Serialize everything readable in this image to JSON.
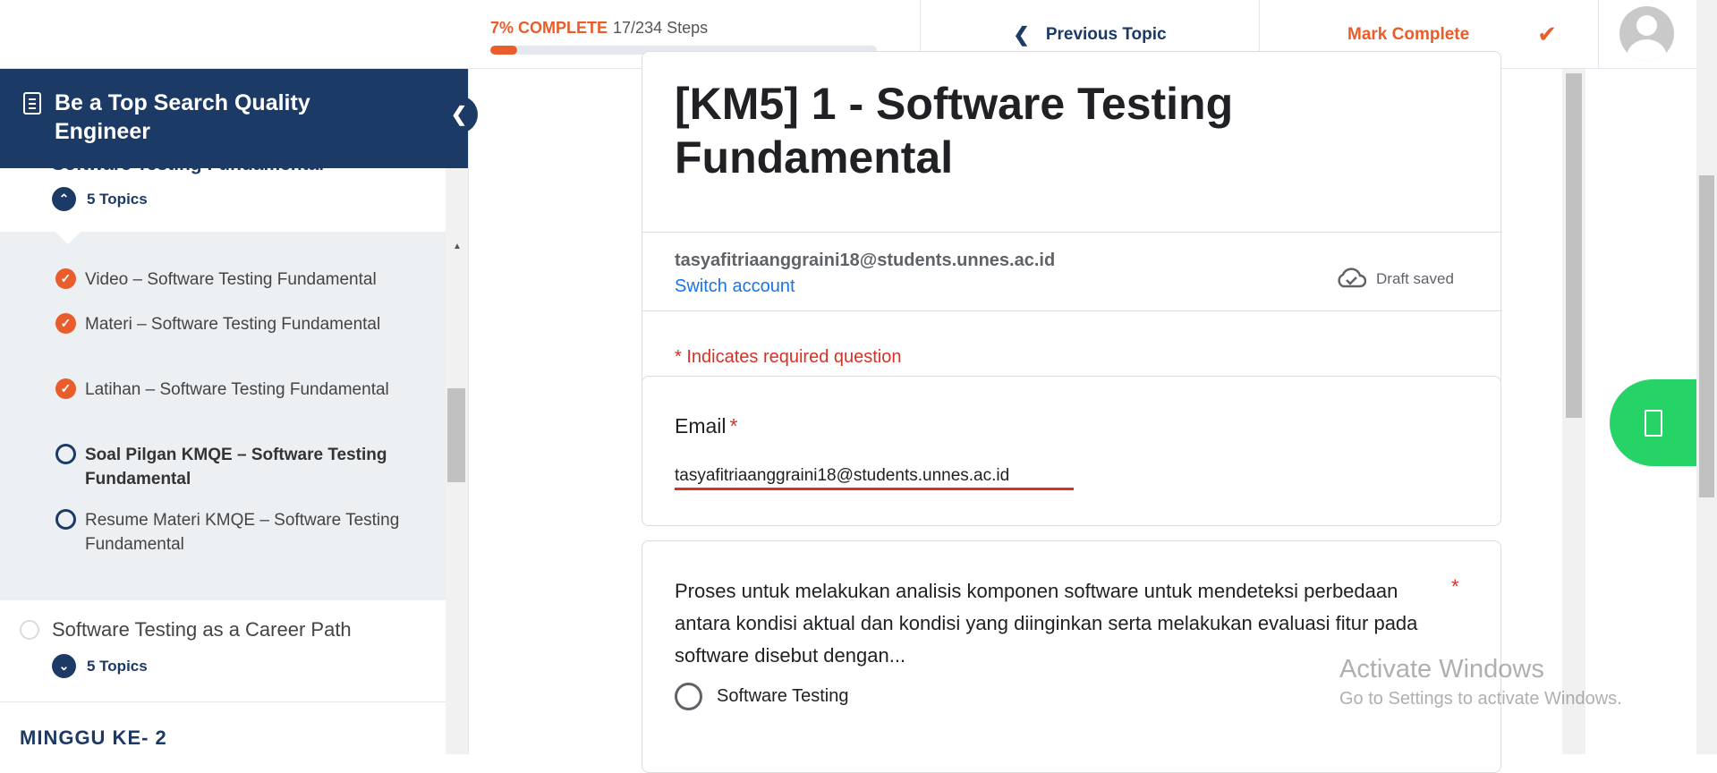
{
  "header": {
    "progress_percent_label": "7% COMPLETE",
    "progress_steps": "17/234 Steps",
    "progress_fraction": 0.07,
    "previous_topic_label": "Previous Topic",
    "mark_complete_label": "Mark Complete"
  },
  "sidebar": {
    "course_title": "Be a Top Search Quality Engineer",
    "current_lesson": "Software Testing Fundamental",
    "current_lesson_topics": "5 Topics",
    "topics": [
      {
        "label": "Video – Software Testing Fundamental",
        "status": "complete"
      },
      {
        "label": "Materi – Software Testing Fundamental",
        "status": "complete"
      },
      {
        "label": "Latihan – Software Testing Fundamental",
        "status": "complete"
      },
      {
        "label": "Soal Pilgan KMQE – Software Testing Fundamental",
        "status": "current"
      },
      {
        "label": "Resume Materi KMQE – Software Testing Fundamental",
        "status": "incomplete"
      }
    ],
    "next_lesson": "Software Testing as a Career Path",
    "next_lesson_topics": "5 Topics",
    "next_section": "MINGGU KE- 2"
  },
  "form": {
    "title": "[KM5] 1 - Software Testing Fundamental",
    "account_email": "tasyafitriaanggraini18@students.unnes.ac.id",
    "switch_account": "Switch account",
    "draft_status": "Draft saved",
    "required_note": "* Indicates required question",
    "email_label": "Email",
    "required_mark": "*",
    "email_value": "tasyafitriaanggraini18@students.unnes.ac.id",
    "question_1": "Proses untuk melakukan analisis komponen software untuk mendeteksi perbedaan antara kondisi aktual dan kondisi yang diinginkan serta melakukan evaluasi fitur pada software disebut dengan...",
    "question_1_option_1": "Software Testing"
  },
  "watermark": {
    "line1": "Activate Windows",
    "line2": "Go to Settings to activate Windows."
  },
  "colors": {
    "brand_navy": "#1b3a66",
    "accent_orange": "#e85d2b",
    "whatsapp_green": "#25d366",
    "required_red": "#d93025",
    "link_blue": "#1a73e8"
  },
  "icons": [
    "chevron-left-icon",
    "check-icon",
    "avatar-icon",
    "document-icon",
    "chevron-up-icon",
    "chevron-down-icon",
    "cloud-check-icon",
    "whatsapp-icon"
  ]
}
